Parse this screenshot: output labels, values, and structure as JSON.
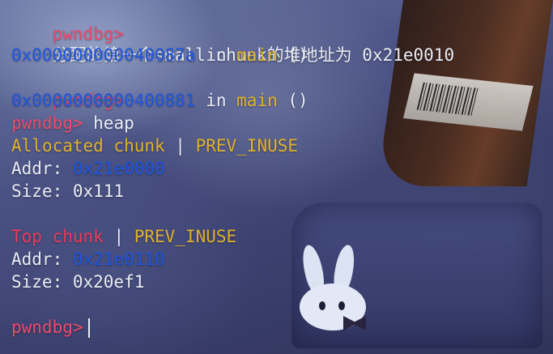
{
  "terminal": {
    "prompt": "pwndbg>",
    "lines": {
      "l1_prompt": "pwndbg>",
      "l2_text": "分配的第一个small chunk的堆地址为 0x21e0010",
      "l3_addr": "0x000000000040087a",
      "l3_in": " in ",
      "l3_fn": "main",
      "l3_args": " ()",
      "l4_prompt": "pwndbg>",
      "l5_addr": "0x0000000000400881",
      "l5_in": " in ",
      "l5_fn": "main",
      "l5_args": " ()",
      "l6_prompt": "pwndbg>",
      "l6_cmd": " heap",
      "l7_type": "Allocated chunk",
      "l7_sep": " | ",
      "l7_flag": "PREV_INUSE",
      "l8_label": "Addr: ",
      "l8_value": "0x21e0000",
      "l9_label": "Size: ",
      "l9_value": "0x111",
      "l11_type": "Top chunk",
      "l11_sep": " | ",
      "l11_flag": "PREV_INUSE",
      "l12_label": "Addr: ",
      "l12_value": "0x21e0110",
      "l13_label": "Size: ",
      "l13_value": "0x20ef1",
      "l15_prompt": "pwndbg>"
    }
  },
  "colors": {
    "prompt": "#ee4a6a",
    "address": "#1f57e0",
    "function": "#e0b22c",
    "text": "#e9ecf4",
    "top_chunk": "#ee3a5a"
  }
}
